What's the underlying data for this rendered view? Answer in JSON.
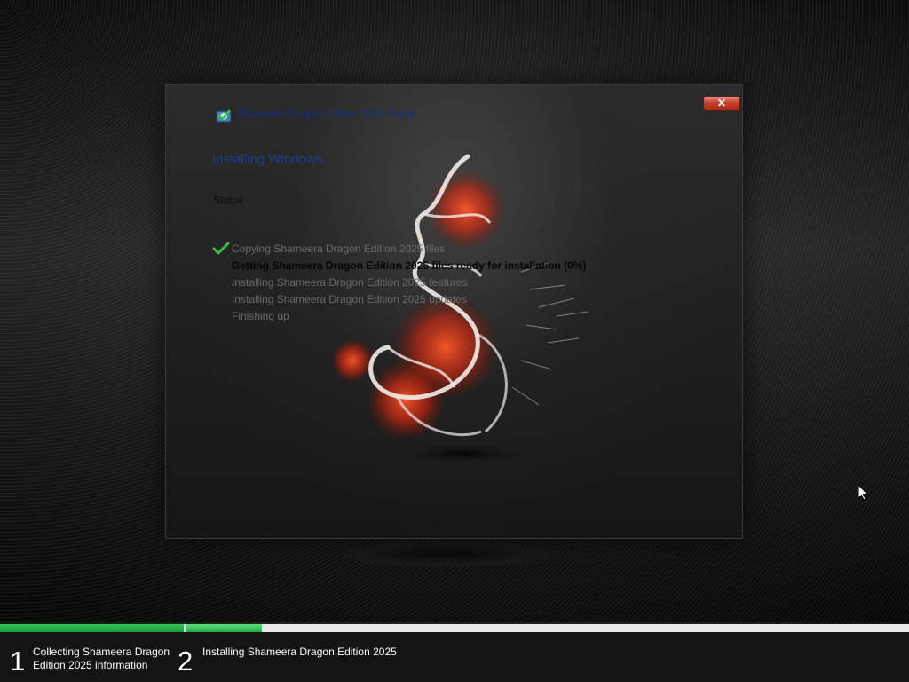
{
  "window": {
    "title": "Shameera Dragon Edition 2025 Setup",
    "close_label": "✕",
    "heading": "Installing Windows",
    "status_label": "Status",
    "steps": [
      {
        "label": "Copying Shameera Dragon Edition 2025 files",
        "state": "done"
      },
      {
        "label": "Getting Shameera Dragon Edition 2025 files ready for installation (0%)",
        "state": "active"
      },
      {
        "label": "Installing Shameera Dragon Edition 2025 features",
        "state": "pending"
      },
      {
        "label": "Installing Shameera Dragon Edition 2025 updates",
        "state": "pending"
      },
      {
        "label": "Finishing up",
        "state": "pending"
      }
    ]
  },
  "progress": {
    "stage1_fraction": 1.0,
    "stage2_fraction": 0.104,
    "colors": {
      "fill": "#22a844",
      "track": "#d8d8d8"
    }
  },
  "bottom_steps": [
    {
      "number": "1",
      "label_line1": "Collecting Shameera Dragon",
      "label_line2": "Edition 2025 information"
    },
    {
      "number": "2",
      "label_line1": "Installing Shameera Dragon Edition 2025",
      "label_line2": ""
    }
  ],
  "icons": {
    "title": "setup-disc-icon",
    "check": "checkmark-icon",
    "close": "close-icon",
    "cursor": "mouse-pointer-icon"
  },
  "colors": {
    "accent_heading": "#1f3c8a",
    "close_button": "#c8402e"
  }
}
